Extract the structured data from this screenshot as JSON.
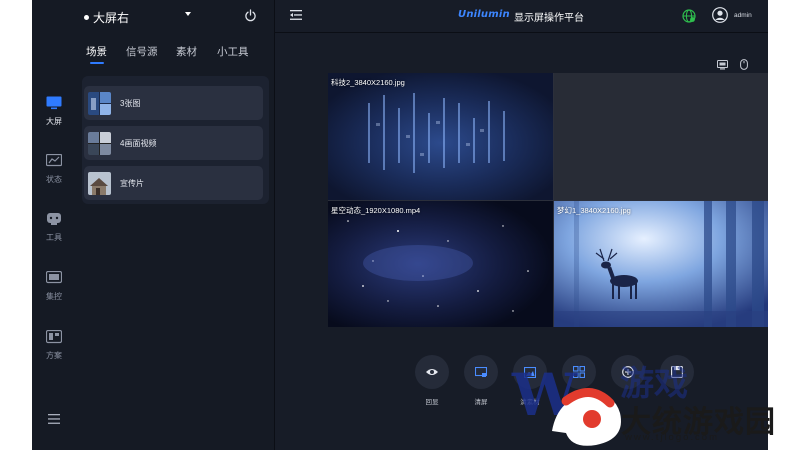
{
  "colors": {
    "accent": "#2f7bff",
    "background": "#151a24",
    "panel": "#1c2230",
    "item": "#2a3040"
  },
  "rail": {
    "items": [
      {
        "label": "大屏",
        "icon": "monitor-icon",
        "active": true
      },
      {
        "label": "状态",
        "icon": "chart-icon",
        "active": false
      },
      {
        "label": "工具",
        "icon": "toolbox-icon",
        "active": false
      },
      {
        "label": "集控",
        "icon": "control-icon",
        "active": false
      },
      {
        "label": "方案",
        "icon": "plan-icon",
        "active": false
      }
    ],
    "menu_icon": "menu-icon"
  },
  "panel": {
    "screen_name": "大屏右",
    "tabs": [
      {
        "label": "场景",
        "active": true
      },
      {
        "label": "信号源",
        "active": false
      },
      {
        "label": "素材",
        "active": false
      },
      {
        "label": "小工具",
        "active": false
      }
    ],
    "scenes": [
      {
        "label": "3张图"
      },
      {
        "label": "4画面视频"
      },
      {
        "label": "宣传片"
      }
    ]
  },
  "header": {
    "brand": "Unilumin",
    "title": "显示屏操作平台",
    "user": "admin"
  },
  "canvas": {
    "windows": [
      {
        "label": "科技2_3840X2160.jpg"
      },
      {
        "label": ""
      },
      {
        "label": "星空动态_1920X1080.mp4"
      },
      {
        "label": "梦幻1_3840X2160.jpg"
      }
    ]
  },
  "actions": [
    {
      "label": "回显",
      "icon": "eye-icon"
    },
    {
      "label": "清屏",
      "icon": "clear-screen-icon"
    },
    {
      "label": "清素材",
      "icon": "image-icon"
    },
    {
      "label": "模板",
      "icon": "grid-icon"
    },
    {
      "label": "",
      "icon": "plus-circle-icon"
    },
    {
      "label": "",
      "icon": "save-icon"
    }
  ],
  "watermark": {
    "letter": "W",
    "text": "大统游戏园",
    "url": "www.tjlogo.com"
  }
}
